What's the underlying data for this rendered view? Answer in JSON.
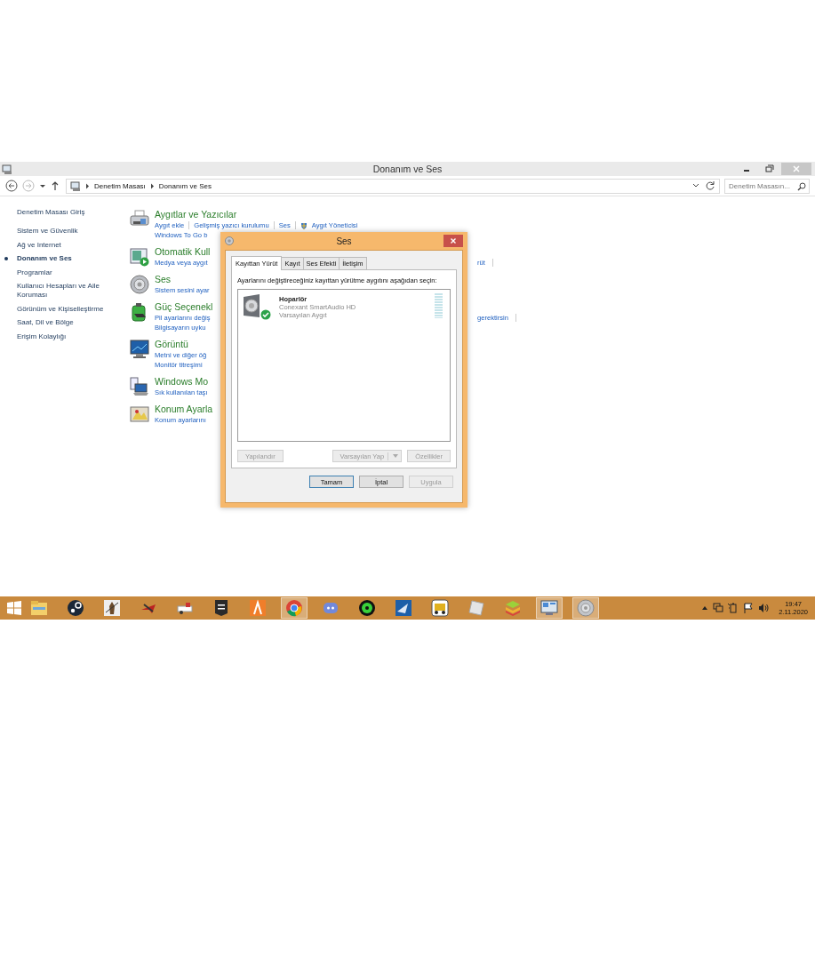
{
  "window": {
    "title": "Donanım ve Ses"
  },
  "address_bar": {
    "breadcrumbs": [
      "Denetim Masası",
      "Donanım ve Ses"
    ]
  },
  "search": {
    "placeholder": "Denetim Masasın..."
  },
  "sidebar": {
    "items": [
      {
        "label": "Denetim Masası Giriş",
        "selected": false
      },
      {
        "label": "Sistem ve Güvenlik",
        "selected": false
      },
      {
        "label": "Ağ ve Internet",
        "selected": false
      },
      {
        "label": "Donanım ve Ses",
        "selected": true
      },
      {
        "label": "Programlar",
        "selected": false
      },
      {
        "label": "Kullanıcı Hesapları ve Aile Koruması",
        "selected": false
      },
      {
        "label": "Görünüm ve Kişiselleştirme",
        "selected": false
      },
      {
        "label": "Saat, Dil ve Bölge",
        "selected": false
      },
      {
        "label": "Erişim Kolaylığı",
        "selected": false
      }
    ]
  },
  "categories": [
    {
      "kind": "printer",
      "title": "Aygıtlar ve Yazıcılar",
      "lines": [
        {
          "links": [
            {
              "text": "Aygıt ekle"
            },
            {
              "text": "Gelişmiş yazıcı kurulumu"
            },
            {
              "text": "Ses"
            },
            {
              "text": "Aygıt Yöneticisi",
              "shield": true
            }
          ]
        },
        {
          "links": [
            {
              "text": "Windows To Go b"
            }
          ]
        }
      ]
    },
    {
      "kind": "autoplay",
      "title": "Otomatik Kull",
      "lines": [
        {
          "links": [
            {
              "text": "Medya veya aygıt"
            }
          ],
          "after": "rüt"
        }
      ]
    },
    {
      "kind": "speaker",
      "title": "Ses",
      "lines": [
        {
          "links": [
            {
              "text": "Sistem sesini ayar"
            }
          ]
        }
      ]
    },
    {
      "kind": "battery",
      "title": "Güç Seçenekl",
      "lines": [
        {
          "links": [
            {
              "text": "Pil ayarlarını değiş"
            }
          ],
          "after": "gerektirsin"
        },
        {
          "links": [
            {
              "text": "Bilgisayarın uyku"
            }
          ]
        }
      ]
    },
    {
      "kind": "monitor",
      "title": "Görüntü",
      "lines": [
        {
          "links": [
            {
              "text": "Metni ve diğer öğ"
            }
          ]
        },
        {
          "links": [
            {
              "text": "Monitör titreşimi"
            }
          ]
        }
      ]
    },
    {
      "kind": "mobility",
      "title": "Windows Mo",
      "lines": [
        {
          "links": [
            {
              "text": "Sık kullanılan taşı"
            }
          ]
        }
      ]
    },
    {
      "kind": "location",
      "title": "Konum Ayarla",
      "lines": [
        {
          "links": [
            {
              "text": "Konum ayarlarını"
            }
          ]
        }
      ]
    }
  ],
  "dialog": {
    "title": "Ses",
    "tabs": [
      {
        "label": "Kayıttan Yürüt",
        "selected": true
      },
      {
        "label": "Kayıt",
        "selected": false
      },
      {
        "label": "Ses Efekti",
        "selected": false
      },
      {
        "label": "İletişim",
        "selected": false
      }
    ],
    "instruction": "Ayarlarını değiştireceğiniz kayıttan yürütme aygıtını aşağıdan seçin:",
    "devices": [
      {
        "name": "Hoparlör",
        "driver": "Conexant SmartAudio HD",
        "status": "Varsayılan Aygıt",
        "default": true,
        "selected": false,
        "level": 0
      }
    ],
    "buttons": [
      {
        "label": "Yapılandır",
        "kind": "plain",
        "disabled": true
      },
      {
        "label": "Varsayılan Yap",
        "kind": "split",
        "disabled": true
      },
      {
        "label": "Özellikler",
        "kind": "plain",
        "disabled": true
      }
    ],
    "footer_buttons": [
      {
        "label": "Tamam",
        "default": true,
        "disabled": false
      },
      {
        "label": "İptal",
        "default": false,
        "disabled": false
      },
      {
        "label": "Uygula",
        "default": false,
        "disabled": true
      }
    ]
  },
  "taskbar": {
    "apps": [
      {
        "kind": "explorer",
        "active": false
      },
      {
        "kind": "steam",
        "active": false
      },
      {
        "kind": "warrior",
        "active": false
      },
      {
        "kind": "plane",
        "active": false
      },
      {
        "kind": "truck-sign",
        "active": false
      },
      {
        "kind": "epic",
        "active": false
      },
      {
        "kind": "orange-a",
        "active": false
      },
      {
        "kind": "chrome",
        "active": true
      },
      {
        "kind": "discord",
        "active": false
      },
      {
        "kind": "green-disc",
        "active": false
      },
      {
        "kind": "blue-game",
        "active": false
      },
      {
        "kind": "truck",
        "active": false
      },
      {
        "kind": "roblox",
        "active": false
      },
      {
        "kind": "bluestacks",
        "active": false
      },
      {
        "kind": "control-panel",
        "active": true
      },
      {
        "kind": "speaker",
        "active": true
      }
    ],
    "time": "19:47",
    "date": "2.11.2020"
  }
}
